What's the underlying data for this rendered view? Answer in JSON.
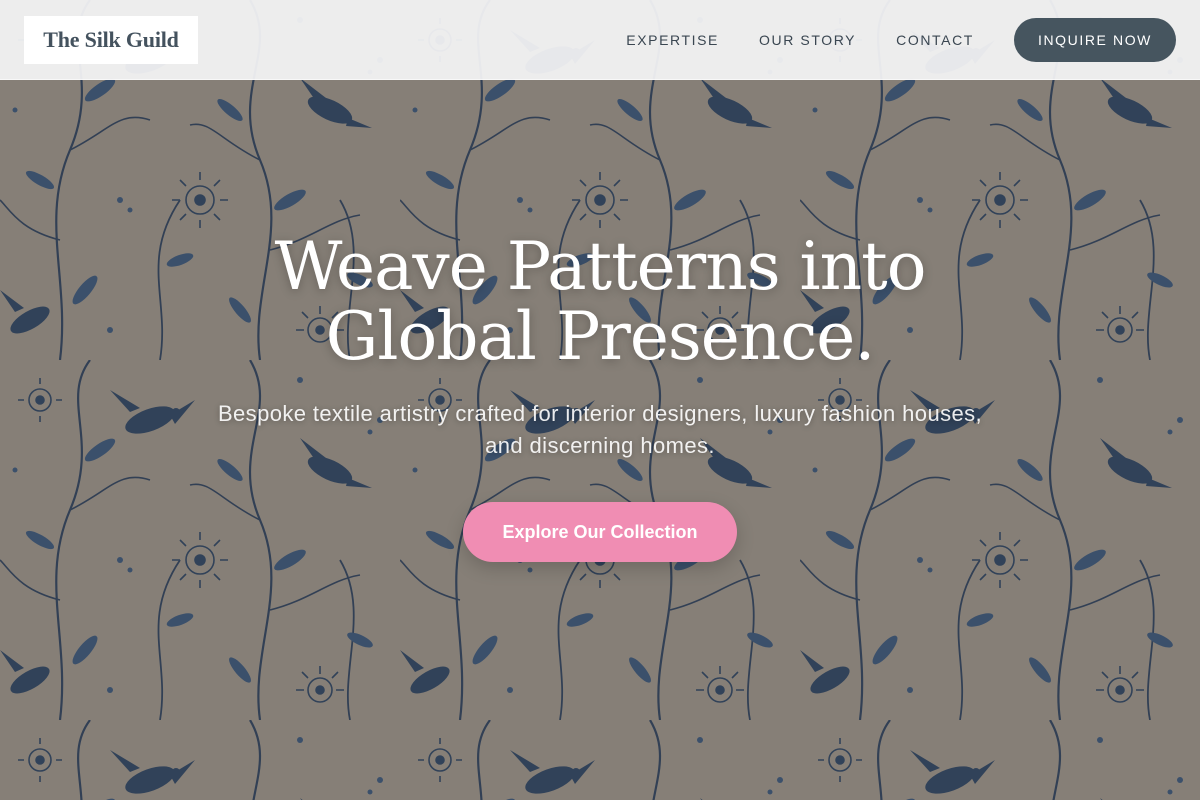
{
  "brand": {
    "name": "The Silk Guild"
  },
  "nav": {
    "items": [
      {
        "label": "EXPERTISE"
      },
      {
        "label": "OUR STORY"
      },
      {
        "label": "CONTACT"
      }
    ],
    "cta_label": "INQUIRE NOW"
  },
  "hero": {
    "title_line1": "Weave Patterns into",
    "title_line2": "Global Presence.",
    "subtitle_line1": "Bespoke textile artistry crafted for interior designers, luxury fashion houses,",
    "subtitle_line2": "and discerning homes.",
    "button_label": "Explore Our Collection",
    "background_description_icon": "floral-textile-pattern"
  },
  "colors": {
    "header_bg": "#f5f5f6",
    "brand_text": "#44525e",
    "nav_text": "#3a4651",
    "cta_bg": "#46555f",
    "hero_button_bg": "#f08db3",
    "fabric_base": "#a39c92",
    "ink_blue": "#2d4768"
  }
}
